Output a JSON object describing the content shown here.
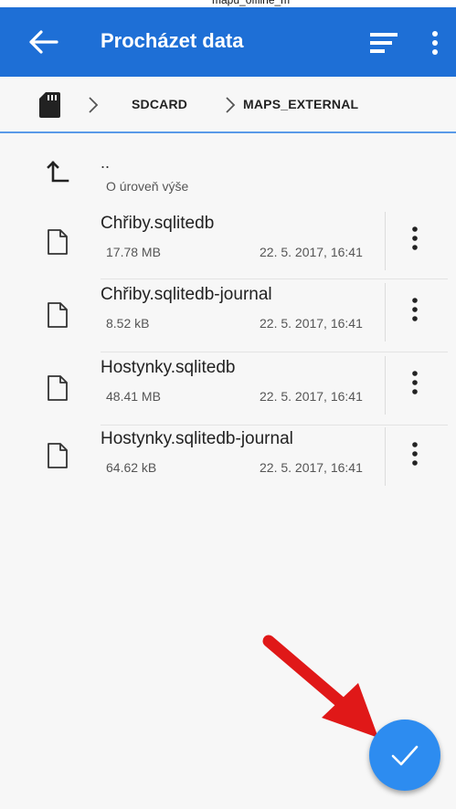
{
  "topbar_fragment": "mapu_offline_mapy",
  "appbar": {
    "title": "Procházet data",
    "colors": {
      "background": "#1e6fd6",
      "text": "#ffffff"
    },
    "icons": [
      "arrow-left-icon",
      "sort-lines-icon",
      "more-vertical-icon"
    ]
  },
  "breadcrumb": {
    "items": [
      "SDCARD",
      "MAPS_EXTERNAL"
    ],
    "icons": [
      "sd-card-icon",
      "chevron-right-icon"
    ]
  },
  "parent_item": {
    "name": "..",
    "label": "O úroveň výše",
    "icon": "level-up-icon"
  },
  "files": [
    {
      "name": "Chřiby.sqlitedb",
      "size": "17.78 MB",
      "date": "22. 5. 2017, 16:41"
    },
    {
      "name": "Chřiby.sqlitedb-journal",
      "size": "8.52 kB",
      "date": "22. 5. 2017, 16:41"
    },
    {
      "name": "Hostynky.sqlitedb",
      "size": "48.41 MB",
      "date": "22. 5. 2017, 16:41"
    },
    {
      "name": "Hostynky.sqlitedb-journal",
      "size": "64.62 kB",
      "date": "22. 5. 2017, 16:41"
    }
  ],
  "fab": {
    "icon": "check-icon",
    "color": "#2d8cf0"
  },
  "annotation": {
    "icon": "red-arrow-icon",
    "color": "#e01818"
  }
}
